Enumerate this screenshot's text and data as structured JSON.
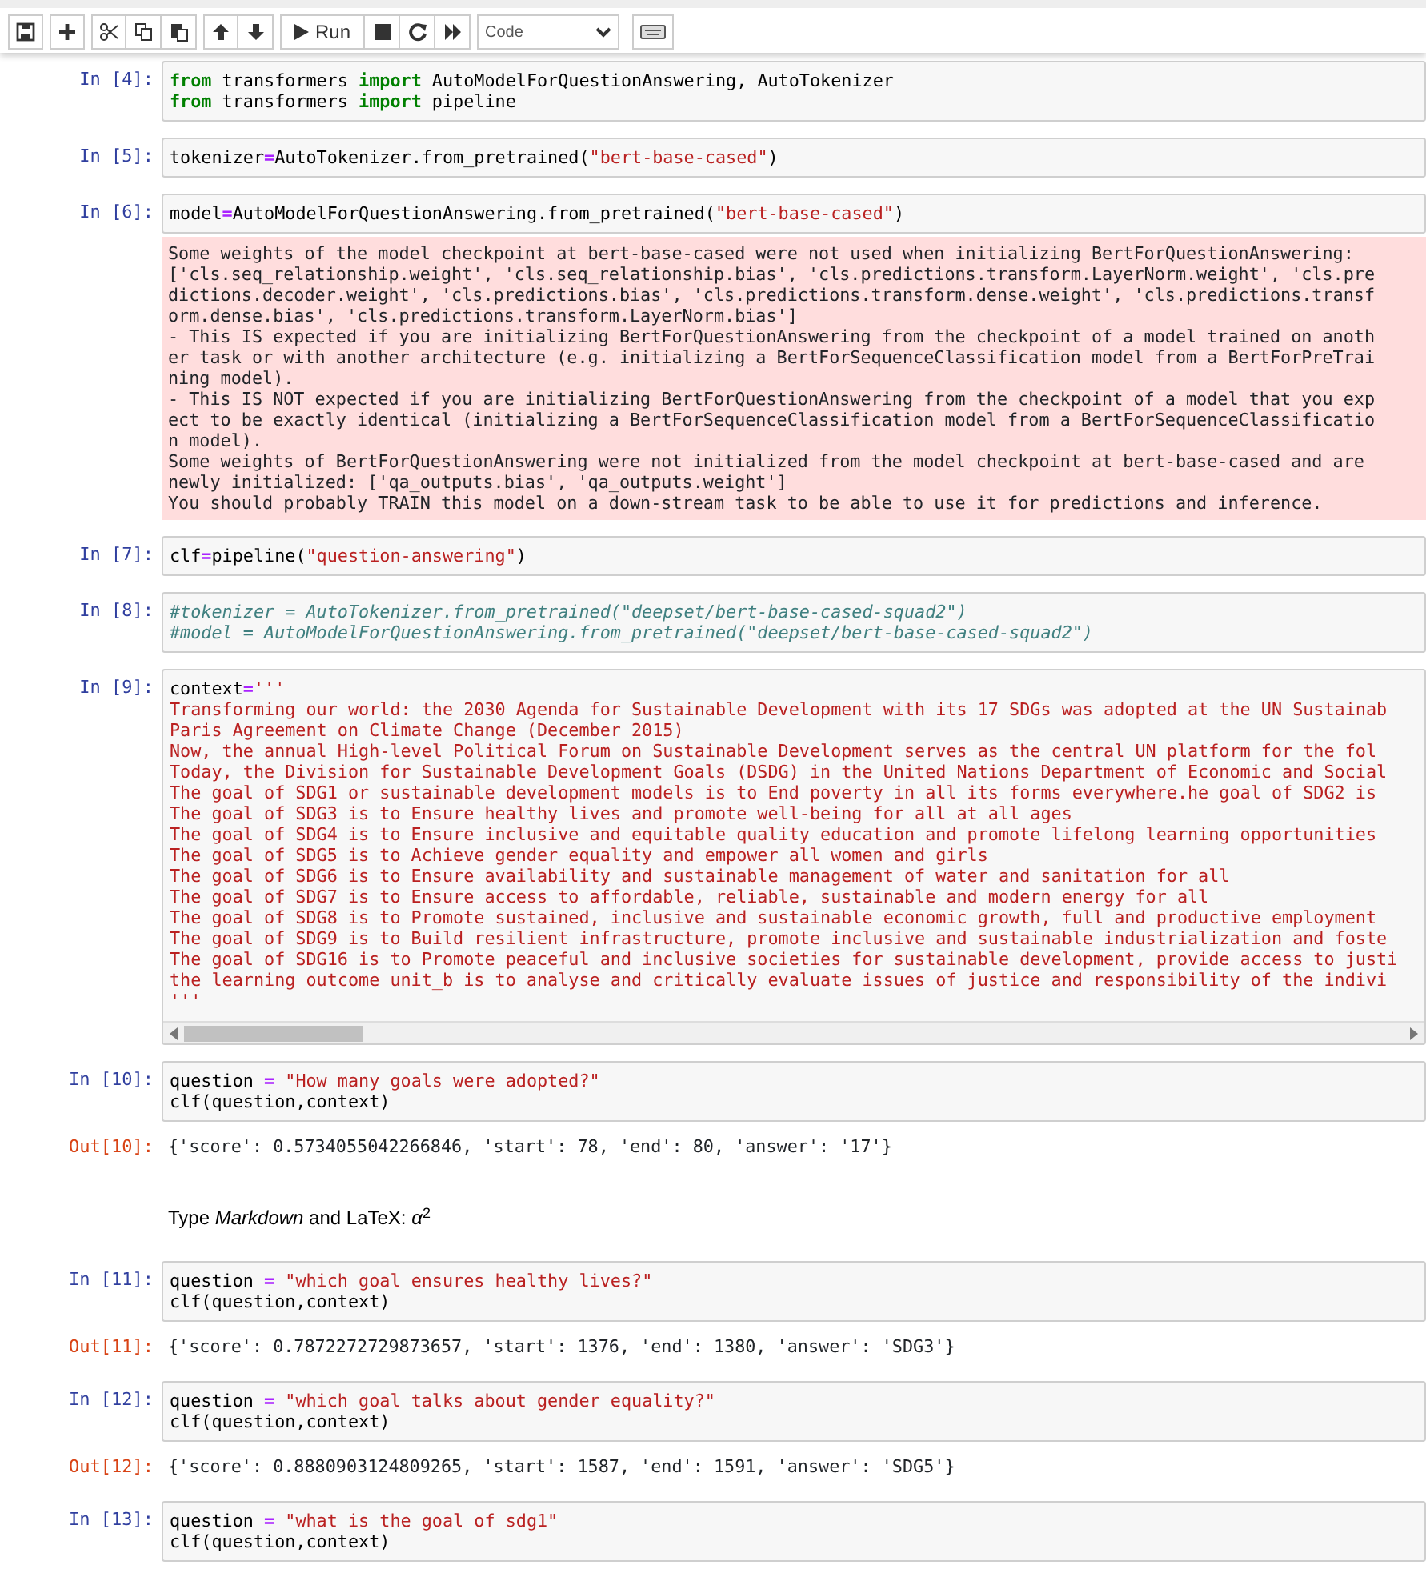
{
  "toolbar": {
    "run_label": "Run",
    "cell_type": "Code"
  },
  "cells": [
    {
      "kind": "code",
      "prompt": "In [4]:",
      "lines": [
        [
          {
            "text": "from",
            "kind": "k"
          },
          {
            "text": " transformers ",
            "kind": "n"
          },
          {
            "text": "import",
            "kind": "k"
          },
          {
            "text": " AutoModelForQuestionAnswering, AutoTokenizer",
            "kind": "n"
          }
        ],
        [
          {
            "text": "from",
            "kind": "k"
          },
          {
            "text": " transformers ",
            "kind": "n"
          },
          {
            "text": "import",
            "kind": "k"
          },
          {
            "text": " pipeline",
            "kind": "n"
          }
        ]
      ]
    },
    {
      "kind": "code",
      "prompt": "In [5]:",
      "lines": [
        [
          {
            "text": "tokenizer",
            "kind": "n"
          },
          {
            "text": "=",
            "kind": "o"
          },
          {
            "text": "AutoTokenizer.from_pretrained(",
            "kind": "n"
          },
          {
            "text": "\"bert-base-cased\"",
            "kind": "s"
          },
          {
            "text": ")",
            "kind": "n"
          }
        ]
      ]
    },
    {
      "kind": "code",
      "prompt": "In [6]:",
      "lines": [
        [
          {
            "text": "model",
            "kind": "n"
          },
          {
            "text": "=",
            "kind": "o"
          },
          {
            "text": "AutoModelForQuestionAnswering.from_pretrained(",
            "kind": "n"
          },
          {
            "text": "\"bert-base-cased\"",
            "kind": "s"
          },
          {
            "text": ")",
            "kind": "n"
          }
        ]
      ],
      "outputs": [
        {
          "kind": "stderr",
          "lines": [
            "Some weights of the model checkpoint at bert-base-cased were not used when initializing BertForQuestionAnswering:",
            "['cls.seq_relationship.weight', 'cls.seq_relationship.bias', 'cls.predictions.transform.LayerNorm.weight', 'cls.pre",
            "dictions.decoder.weight', 'cls.predictions.bias', 'cls.predictions.transform.dense.weight', 'cls.predictions.transf",
            "orm.dense.bias', 'cls.predictions.transform.LayerNorm.bias']",
            "- This IS expected if you are initializing BertForQuestionAnswering from the checkpoint of a model trained on anoth",
            "er task or with another architecture (e.g. initializing a BertForSequenceClassification model from a BertForPreTrai",
            "ning model).",
            "- This IS NOT expected if you are initializing BertForQuestionAnswering from the checkpoint of a model that you exp",
            "ect to be exactly identical (initializing a BertForSequenceClassification model from a BertForSequenceClassificatio",
            "n model).",
            "Some weights of BertForQuestionAnswering were not initialized from the model checkpoint at bert-base-cased and are",
            "newly initialized: ['qa_outputs.bias', 'qa_outputs.weight']",
            "You should probably TRAIN this model on a down-stream task to be able to use it for predictions and inference."
          ]
        }
      ]
    },
    {
      "kind": "code",
      "prompt": "In [7]:",
      "lines": [
        [
          {
            "text": "clf",
            "kind": "n"
          },
          {
            "text": "=",
            "kind": "o"
          },
          {
            "text": "pipeline(",
            "kind": "n"
          },
          {
            "text": "\"question-answering\"",
            "kind": "s"
          },
          {
            "text": ")",
            "kind": "n"
          }
        ]
      ]
    },
    {
      "kind": "code",
      "prompt": "In [8]:",
      "lines": [
        [
          {
            "text": "#tokenizer = AutoTokenizer.from_pretrained(\"deepset/bert-base-cased-squad2\")",
            "kind": "c"
          }
        ],
        [
          {
            "text": "#model = AutoModelForQuestionAnswering.from_pretrained(\"deepset/bert-base-cased-squad2\")",
            "kind": "c"
          }
        ]
      ]
    },
    {
      "kind": "code",
      "prompt": "In [9]:",
      "scrollbar": true,
      "lines": [
        [
          {
            "text": "context",
            "kind": "n"
          },
          {
            "text": "=",
            "kind": "o"
          },
          {
            "text": "'''",
            "kind": "s"
          }
        ],
        [
          {
            "text": "Transforming our world: the 2030 Agenda for Sustainable Development with its 17 SDGs was adopted at the UN Sustainab",
            "kind": "s"
          }
        ],
        [
          {
            "text": "Paris Agreement on Climate Change (December 2015)",
            "kind": "s"
          }
        ],
        [
          {
            "text": "Now, the annual High-level Political Forum on Sustainable Development serves as the central UN platform for the fol",
            "kind": "s"
          }
        ],
        [
          {
            "text": "Today, the Division for Sustainable Development Goals (DSDG) in the United Nations Department of Economic and Social",
            "kind": "s"
          }
        ],
        [
          {
            "text": "The goal of SDG1 or sustainable development models is to End poverty in all its forms everywhere.he goal of SDG2 is",
            "kind": "s"
          }
        ],
        [
          {
            "text": "The goal of SDG3 is to Ensure healthy lives and promote well-being for all at all ages",
            "kind": "s"
          }
        ],
        [
          {
            "text": "The goal of SDG4 is to Ensure inclusive and equitable quality education and promote lifelong learning opportunities",
            "kind": "s"
          }
        ],
        [
          {
            "text": "The goal of SDG5 is to Achieve gender equality and empower all women and girls",
            "kind": "s"
          }
        ],
        [
          {
            "text": "The goal of SDG6 is to Ensure availability and sustainable management of water and sanitation for all",
            "kind": "s"
          }
        ],
        [
          {
            "text": "The goal of SDG7 is to Ensure access to affordable, reliable, sustainable and modern energy for all",
            "kind": "s"
          }
        ],
        [
          {
            "text": "The goal of SDG8 is to Promote sustained, inclusive and sustainable economic growth, full and productive employment",
            "kind": "s"
          }
        ],
        [
          {
            "text": "The goal of SDG9 is to Build resilient infrastructure, promote inclusive and sustainable industrialization and foste",
            "kind": "s"
          }
        ],
        [
          {
            "text": "The goal of SDG16 is to Promote peaceful and inclusive societies for sustainable development, provide access to justi",
            "kind": "s"
          }
        ],
        [
          {
            "text": "the learning outcome unit_b is to analyse and critically evaluate issues of justice and responsibility of the indivi",
            "kind": "s"
          }
        ],
        [
          {
            "text": "'''",
            "kind": "s"
          }
        ]
      ]
    },
    {
      "kind": "code",
      "prompt": "In [10]:",
      "lines": [
        [
          {
            "text": "question ",
            "kind": "n"
          },
          {
            "text": "=",
            "kind": "o"
          },
          {
            "text": " \"How many goals were adopted?\"",
            "kind": "s"
          }
        ],
        [
          {
            "text": "clf(question,context)",
            "kind": "n"
          }
        ]
      ],
      "outputs": [
        {
          "kind": "result",
          "prompt": "Out[10]:",
          "lines": [
            "{'score': 0.5734055042266846, 'start': 78, 'end': 80, 'answer': '17'}"
          ]
        }
      ]
    },
    {
      "kind": "markdown",
      "text": "Type *Markdown* and LaTeX: *α*$^{2}$"
    },
    {
      "kind": "code",
      "prompt": "In [11]:",
      "lines": [
        [
          {
            "text": "question ",
            "kind": "n"
          },
          {
            "text": "=",
            "kind": "o"
          },
          {
            "text": " \"which goal ensures healthy lives?\"",
            "kind": "s"
          }
        ],
        [
          {
            "text": "clf(question,context)",
            "kind": "n"
          }
        ]
      ],
      "outputs": [
        {
          "kind": "result",
          "prompt": "Out[11]:",
          "lines": [
            "{'score': 0.7872272729873657, 'start': 1376, 'end': 1380, 'answer': 'SDG3'}"
          ]
        }
      ]
    },
    {
      "kind": "code",
      "prompt": "In [12]:",
      "lines": [
        [
          {
            "text": "question ",
            "kind": "n"
          },
          {
            "text": "=",
            "kind": "o"
          },
          {
            "text": " \"which goal talks about gender equality?\"",
            "kind": "s"
          }
        ],
        [
          {
            "text": "clf(question,context)",
            "kind": "n"
          }
        ]
      ],
      "outputs": [
        {
          "kind": "result",
          "prompt": "Out[12]:",
          "lines": [
            "{'score': 0.8880903124809265, 'start': 1587, 'end': 1591, 'answer': 'SDG5'}"
          ]
        }
      ]
    },
    {
      "kind": "code",
      "prompt": "In [13]:",
      "lines": [
        [
          {
            "text": "question ",
            "kind": "n"
          },
          {
            "text": "=",
            "kind": "o"
          },
          {
            "text": " \"what is the goal of sdg1\"",
            "kind": "s"
          }
        ],
        [
          {
            "text": "clf(question,context)",
            "kind": "n"
          }
        ]
      ]
    }
  ]
}
